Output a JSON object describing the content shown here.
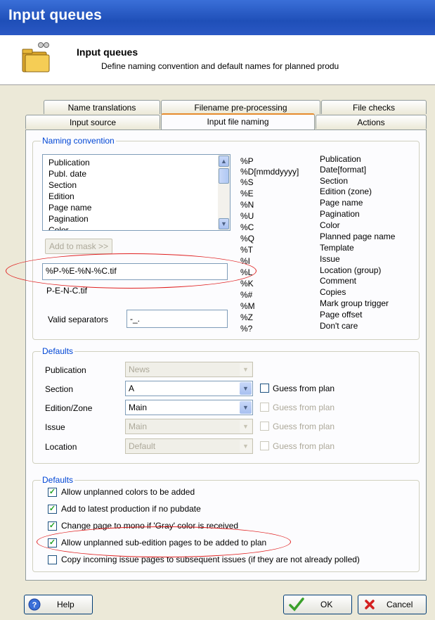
{
  "window": {
    "title": "Input queues"
  },
  "header": {
    "title": "Input queues",
    "subtitle": "Define naming convention and default names for planned produ"
  },
  "tabs": {
    "row1": [
      "Name translations",
      "Filename pre-processing",
      "File checks"
    ],
    "row2": [
      "Input source",
      "Input file naming",
      "Actions"
    ],
    "active": "Input file naming"
  },
  "naming": {
    "group_label": "Naming convention",
    "list_items": [
      "Publication",
      "Publ. date",
      "Section",
      "Edition",
      "Page name",
      "Pagination",
      "Color"
    ],
    "add_button": "Add to mask >>",
    "mask_value": "%P-%E-%N-%C.tif",
    "preview": "P-E-N-C.tif",
    "separators_label": "Valid separators",
    "separators_value": "-_.",
    "codes": [
      "%P",
      "%D[mmddyyyy]",
      "%S",
      "%E",
      "%N",
      "%U",
      "%C",
      "%Q",
      "%T",
      "%I",
      "%L",
      "%K",
      "%#",
      "%M",
      "%Z",
      "%?"
    ],
    "descriptions": [
      "Publication",
      "Date[format]",
      "Section",
      "Edition (zone)",
      "Page name",
      "Pagination",
      "Color",
      "Planned page name",
      "Template",
      "Issue",
      "Location (group)",
      "Comment",
      "Copies",
      "Mark group trigger",
      "Page offset",
      "Don't care"
    ]
  },
  "defaults1": {
    "group_label": "Defaults",
    "rows": [
      {
        "label": "Publication",
        "value": "News",
        "enabled": false
      },
      {
        "label": "Section",
        "value": "A",
        "enabled": true,
        "guess": "Guess from plan",
        "guess_enabled": true
      },
      {
        "label": "Edition/Zone",
        "value": "Main",
        "enabled": true,
        "guess": "Guess from plan",
        "guess_enabled": false
      },
      {
        "label": "Issue",
        "value": "Main",
        "enabled": false,
        "guess": "Guess from plan",
        "guess_enabled": false
      },
      {
        "label": "Location",
        "value": "Default",
        "enabled": false,
        "guess": "Guess from plan",
        "guess_enabled": false
      }
    ]
  },
  "defaults2": {
    "group_label": "Defaults",
    "options": [
      {
        "label": "Allow unplanned colors to be added",
        "checked": true
      },
      {
        "label": "Add to latest production if no pubdate",
        "checked": true
      },
      {
        "label": "Change page to mono if 'Gray' color is received",
        "checked": true
      },
      {
        "label": "Allow unplanned sub-edition pages to be added to plan",
        "checked": true
      },
      {
        "label": "Copy incoming issue pages to subsequent issues (if they are not already polled)",
        "checked": false
      }
    ]
  },
  "footer": {
    "help": "Help",
    "ok": "OK",
    "cancel": "Cancel"
  },
  "colors": {
    "accent_title": "#2a58c4",
    "annotation": "#e02020",
    "tab_highlight": "#e68b2c"
  }
}
